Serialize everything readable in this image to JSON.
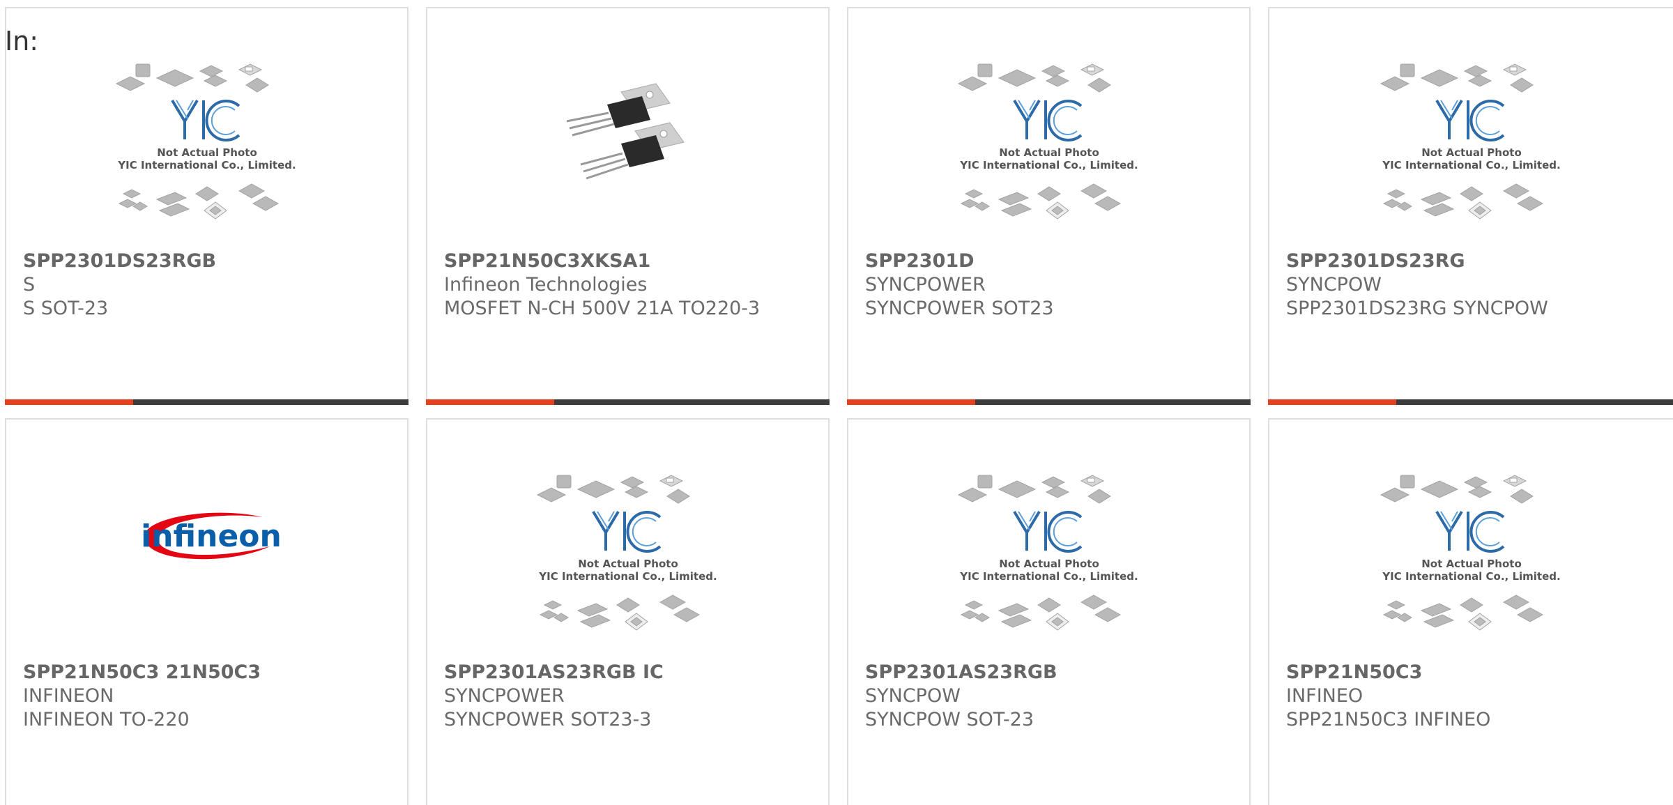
{
  "header": {
    "label": "In:"
  },
  "colors": {
    "accent": "#e8401c",
    "bar": "#3c3c3c"
  },
  "placeholder": {
    "line1": "Not Actual Photo",
    "line2": "YIC International Co., Limited."
  },
  "products": [
    {
      "part": "SPP2301DS23RGB",
      "maker": "S",
      "desc": "S SOT-23",
      "image": "yic-placeholder"
    },
    {
      "part": "SPP21N50C3XKSA1",
      "maker": "Infineon Technologies",
      "desc": "MOSFET N-CH 500V 21A TO220-3",
      "image": "to220-transistor-photo"
    },
    {
      "part": "SPP2301D",
      "maker": "SYNCPOWER",
      "desc": "SYNCPOWER SOT23",
      "image": "yic-placeholder"
    },
    {
      "part": "SPP2301DS23RG",
      "maker": "SYNCPOW",
      "desc": "SPP2301DS23RG SYNCPOW",
      "image": "yic-placeholder"
    },
    {
      "part": "SPP21N50C3 21N50C3",
      "maker": "INFINEON",
      "desc": "INFINEON TO-220",
      "image": "infineon-logo",
      "logo_text": "infineon"
    },
    {
      "part": "SPP2301AS23RGB IC",
      "maker": "SYNCPOWER",
      "desc": "SYNCPOWER SOT23-3",
      "image": "yic-placeholder"
    },
    {
      "part": "SPP2301AS23RGB",
      "maker": "SYNCPOW",
      "desc": "SYNCPOW SOT-23",
      "image": "yic-placeholder"
    },
    {
      "part": "SPP21N50C3",
      "maker": "INFINEO",
      "desc": "SPP21N50C3 INFINEO",
      "image": "yic-placeholder"
    }
  ]
}
